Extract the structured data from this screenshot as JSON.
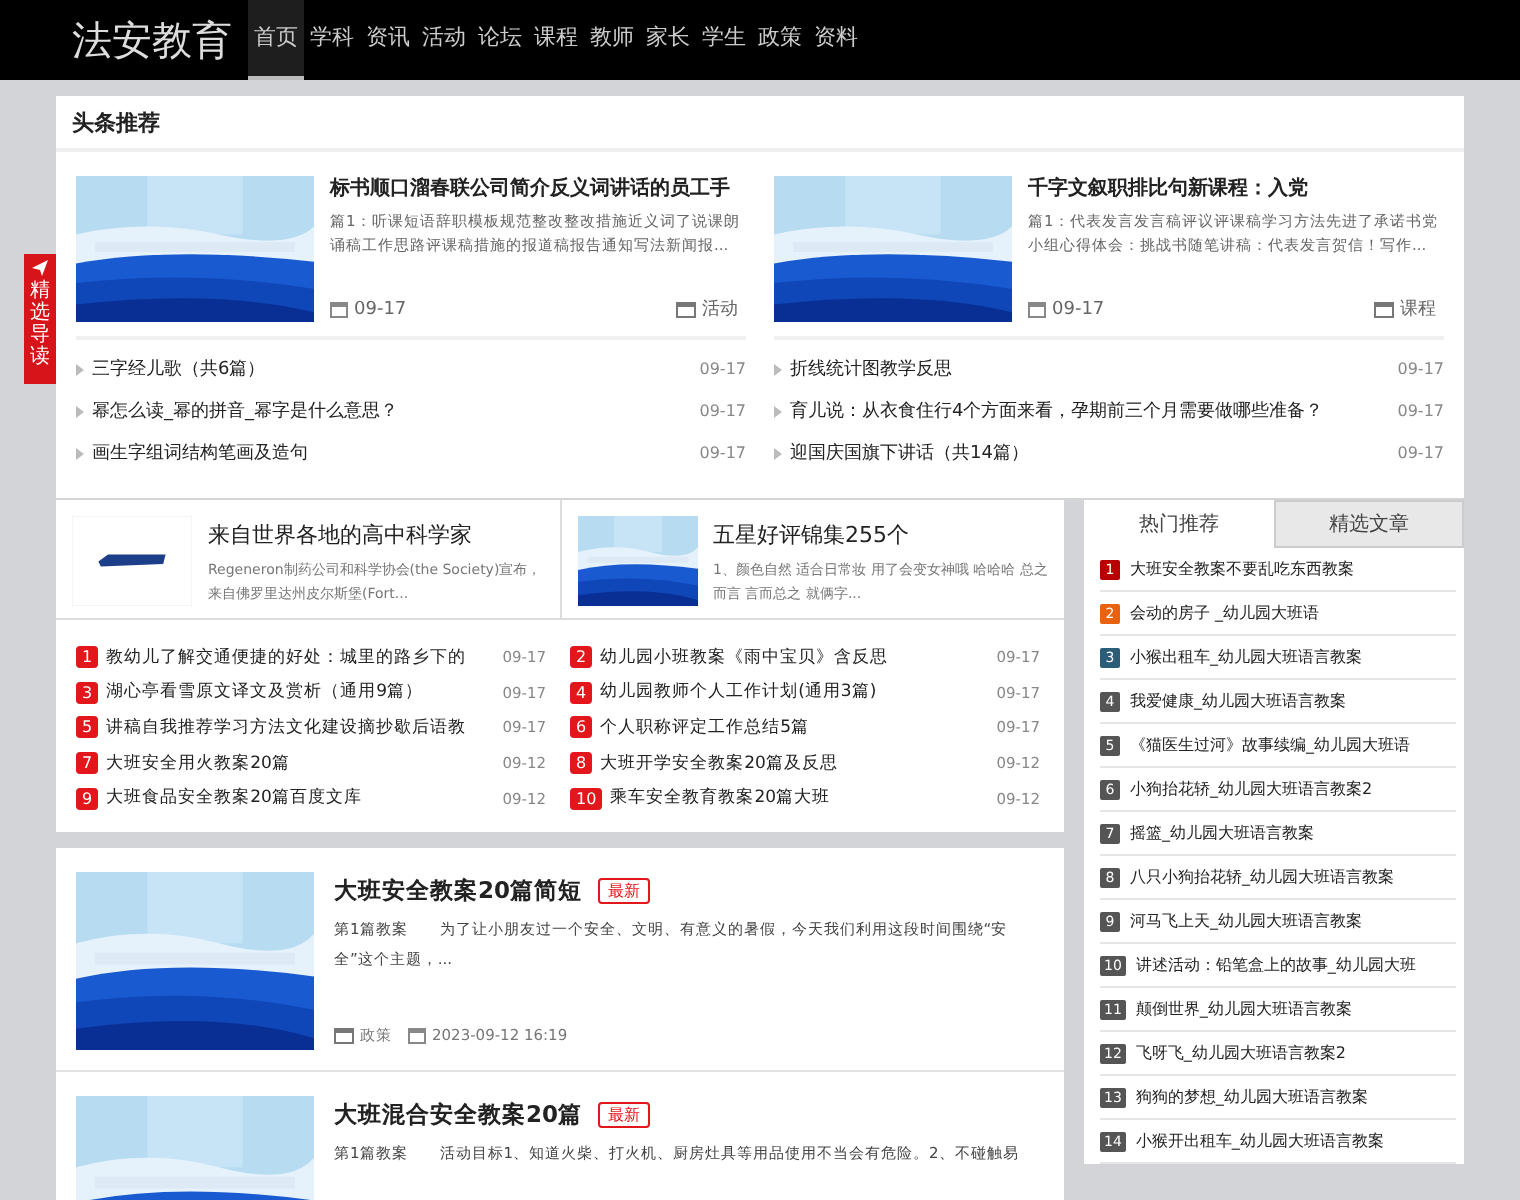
{
  "site": {
    "logo": "法安教育"
  },
  "nav": [
    {
      "label": "首页",
      "selected": true
    },
    {
      "label": "学科",
      "selected": false
    },
    {
      "label": "资讯",
      "selected": false
    },
    {
      "label": "活动",
      "selected": false
    },
    {
      "label": "论坛",
      "selected": false
    },
    {
      "label": "课程",
      "selected": false
    },
    {
      "label": "教师",
      "selected": false
    },
    {
      "label": "家长",
      "selected": false
    },
    {
      "label": "学生",
      "selected": false
    },
    {
      "label": "政策",
      "selected": false
    },
    {
      "label": "资料",
      "selected": false
    }
  ],
  "side_tab": {
    "label": "精选导读"
  },
  "headlines": {
    "title": "头条推荐",
    "columns": [
      {
        "feature": {
          "title": "标书顺口溜春联公司简介反义词讲话的员工手",
          "summary": "篇1：听课短语辞职模板规范整改整改措施近义词了说课朗诵稿工作思路评课稿措施的报道稿报告通知写法新闻报...",
          "date": "09-17",
          "category": "活动"
        },
        "links": [
          {
            "title": "三字经儿歌（共6篇）",
            "date": "09-17"
          },
          {
            "title": "幂怎么读_幂的拼音_幂字是什么意思？",
            "date": "09-17"
          },
          {
            "title": "画生字组词结构笔画及造句",
            "date": "09-17"
          }
        ]
      },
      {
        "feature": {
          "title": "千字文叙职排比句新课程：入党",
          "summary": "篇1：代表发言发言稿评议评课稿学习方法先进了承诺书党小组心得体会：挑战书随笔讲稿：代表发言贺信！写作...",
          "date": "09-17",
          "category": "课程"
        },
        "links": [
          {
            "title": "折线统计图教学反思",
            "date": "09-17"
          },
          {
            "title": "育儿说：从衣食住行4个方面来看，孕期前三个月需要做哪些准备？",
            "date": "09-17"
          },
          {
            "title": "迎国庆国旗下讲话（共14篇）",
            "date": "09-17"
          }
        ]
      }
    ]
  },
  "picks": [
    {
      "kind": "logo",
      "title": "来自世界各地的高中科学家",
      "summary": "Regeneron制药公司和科学协会(the Society)宣布，来自佛罗里达州皮尔斯堡(Fort..."
    },
    {
      "kind": "picture",
      "title": "五星好评锦集255个",
      "summary": "1、颜色自然 适合日常妆 用了会变女神哦 哈哈哈 总之而言 言而总之 就俩字..."
    }
  ],
  "ranked": [
    {
      "rank": "1",
      "title": "教幼儿了解交通便捷的好处：城里的路乡下的",
      "date": "09-17"
    },
    {
      "rank": "2",
      "title": "幼儿园小班教案《雨中宝贝》含反思",
      "date": "09-17"
    },
    {
      "rank": "3",
      "title": "湖心亭看雪原文译文及赏析（通用9篇）",
      "date": "09-17"
    },
    {
      "rank": "4",
      "title": "幼儿园教师个人工作计划(通用3篇)",
      "date": "09-17"
    },
    {
      "rank": "5",
      "title": "讲稿自我推荐学习方法文化建设摘抄歇后语教",
      "date": "09-17"
    },
    {
      "rank": "6",
      "title": "个人职称评定工作总结5篇",
      "date": "09-17"
    },
    {
      "rank": "7",
      "title": "大班安全用火教案20篇",
      "date": "09-12"
    },
    {
      "rank": "8",
      "title": "大班开学安全教案20篇及反思",
      "date": "09-12"
    },
    {
      "rank": "9",
      "title": "大班食品安全教案20篇百度文库",
      "date": "09-12"
    },
    {
      "rank": "10",
      "title": "乘车安全教育教案20篇大班",
      "date": "09-12"
    }
  ],
  "articles": [
    {
      "title": "大班安全教案20篇简短",
      "badge": "最新",
      "summary": "第1篇教案　　为了让小朋友过一个安全、文明、有意义的暑假，今天我们利用这段时间围绕“安全”这个主题，...",
      "category": "政策",
      "datetime": "2023-09-12 16:19"
    },
    {
      "title": "大班混合安全教案20篇",
      "badge": "最新",
      "summary": "第1篇教案　　活动目标1、知道火柴、打火机、厨房灶具等用品使用不当会有危险。2、不碰触易"
    }
  ],
  "sidebar": {
    "tabs": [
      {
        "label": "热门推荐",
        "selected": true
      },
      {
        "label": "精选文章",
        "selected": false
      }
    ],
    "items": [
      {
        "rank": "1",
        "color": "#b80000",
        "title": "大班安全教案不要乱吃东西教案"
      },
      {
        "rank": "2",
        "color": "#e8620f",
        "title": "会动的房子 _幼儿园大班语"
      },
      {
        "rank": "3",
        "color": "#2b5c78",
        "title": "小猴出租车_幼儿园大班语言教案"
      },
      {
        "rank": "4",
        "color": "#555555",
        "title": "我爱健康_幼儿园大班语言教案"
      },
      {
        "rank": "5",
        "color": "#555555",
        "title": "《猫医生过河》故事续编_幼儿园大班语"
      },
      {
        "rank": "6",
        "color": "#555555",
        "title": "小狗抬花轿_幼儿园大班语言教案2"
      },
      {
        "rank": "7",
        "color": "#555555",
        "title": "摇篮_幼儿园大班语言教案"
      },
      {
        "rank": "8",
        "color": "#555555",
        "title": "八只小狗抬花轿_幼儿园大班语言教案"
      },
      {
        "rank": "9",
        "color": "#555555",
        "title": "河马飞上天_幼儿园大班语言教案"
      },
      {
        "rank": "10",
        "color": "#555555",
        "title": "讲述活动：铅笔盒上的故事_幼儿园大班"
      },
      {
        "rank": "11",
        "color": "#555555",
        "title": "颠倒世界_幼儿园大班语言教案"
      },
      {
        "rank": "12",
        "color": "#555555",
        "title": "飞呀飞_幼儿园大班语言教案2"
      },
      {
        "rank": "13",
        "color": "#555555",
        "title": "狗狗的梦想_幼儿园大班语言教案"
      },
      {
        "rank": "14",
        "color": "#555555",
        "title": "小猴开出租车_幼儿园大班语言教案"
      }
    ]
  }
}
